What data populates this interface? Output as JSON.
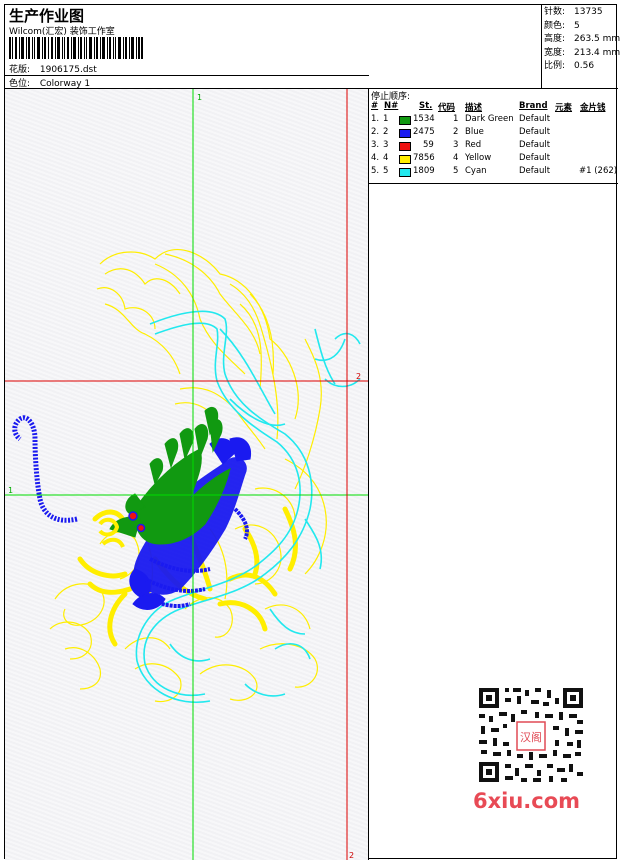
{
  "header": {
    "title": "生产作业图",
    "subtitle": "Wilcom(汇宏)  装饰工作室",
    "design_label": "花版:",
    "design_value": "1906175.dst",
    "colorway_label": "色位:",
    "colorway_value": "Colorway 1"
  },
  "stats": [
    {
      "label": "针数:",
      "value": "13735"
    },
    {
      "label": "颜色:",
      "value": "5"
    },
    {
      "label": "高度:",
      "value": "263.5 mm"
    },
    {
      "label": "宽度:",
      "value": "213.4 mm"
    },
    {
      "label": "比例:",
      "value": "0.56"
    }
  ],
  "stop_sequence": {
    "title": "停止顺序:",
    "columns": [
      "#",
      "N#",
      "St.",
      "代码",
      "描述",
      "Brand",
      "元素",
      "金片钱"
    ],
    "rows": [
      {
        "num": "1.",
        "n": "1",
        "color": "#119911",
        "st": "1534",
        "code": "1",
        "desc": "Dark Green",
        "brand": "Default",
        "extra": ""
      },
      {
        "num": "2.",
        "n": "2",
        "color": "#1a1af0",
        "st": "2475",
        "code": "2",
        "desc": "Blue",
        "brand": "Default",
        "extra": ""
      },
      {
        "num": "3.",
        "n": "3",
        "color": "#ee1111",
        "st": "59",
        "code": "3",
        "desc": "Red",
        "brand": "Default",
        "extra": ""
      },
      {
        "num": "4.",
        "n": "4",
        "color": "#ffee00",
        "st": "7856",
        "code": "4",
        "desc": "Yellow",
        "brand": "Default",
        "extra": ""
      },
      {
        "num": "5.",
        "n": "5",
        "color": "#22e8ee",
        "st": "1809",
        "code": "5",
        "desc": "Cyan",
        "brand": "Default",
        "extra": "#1 (262)"
      }
    ]
  },
  "guides": {
    "green_top_label": "1",
    "green_left_label": "1",
    "red_right_label": "2",
    "red_bottom_label": "2"
  },
  "watermark": {
    "stamp_text": "汉阁",
    "brand_text": "6xiu.com",
    "brand_color": "#e84a55"
  }
}
